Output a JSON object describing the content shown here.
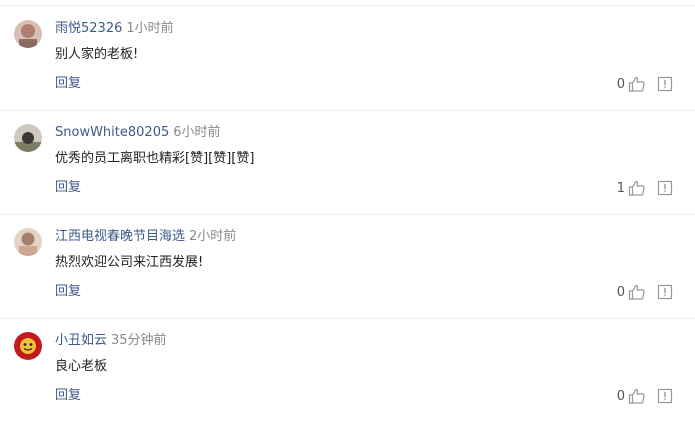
{
  "comments": [
    {
      "username": "雨悦52326",
      "time": "1小时前",
      "text": "别人家的老板!",
      "reply_label": "回复",
      "likes": "0",
      "avatar_color": "#c9a49a"
    },
    {
      "username": "SnowWhite80205",
      "time": "6小时前",
      "text": "优秀的员工离职也精彩[赞][赞][赞]",
      "reply_label": "回复",
      "likes": "1",
      "avatar_color": "#6f6b5d"
    },
    {
      "username": "江西电视春晚节目海选",
      "time": "2小时前",
      "text": "热烈欢迎公司来江西发展!",
      "reply_label": "回复",
      "likes": "0",
      "avatar_color": "#b89684"
    },
    {
      "username": "小丑如云",
      "time": "35分钟前",
      "text": "良心老板",
      "reply_label": "回复",
      "likes": "0",
      "avatar_color": "#c31b1b"
    }
  ],
  "icons": {
    "like": "thumbs-up-icon",
    "report": "report-icon"
  }
}
